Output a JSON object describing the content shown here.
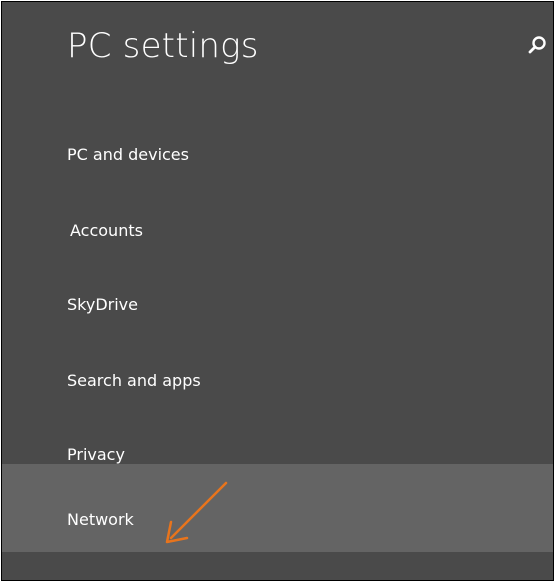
{
  "header": {
    "title": "PC settings",
    "search_icon": "search-icon"
  },
  "menu": {
    "items": [
      {
        "label": "PC and devices",
        "selected": false
      },
      {
        "label": "Accounts",
        "selected": false
      },
      {
        "label": "SkyDrive",
        "selected": false
      },
      {
        "label": "Search and apps",
        "selected": false
      },
      {
        "label": "Privacy",
        "selected": false
      },
      {
        "label": "Network",
        "selected": true
      }
    ]
  },
  "annotation": {
    "type": "arrow-icon",
    "color": "#e8741c"
  },
  "colors": {
    "background": "#4a4a4a",
    "selected": "#646464",
    "text": "#ffffff"
  }
}
